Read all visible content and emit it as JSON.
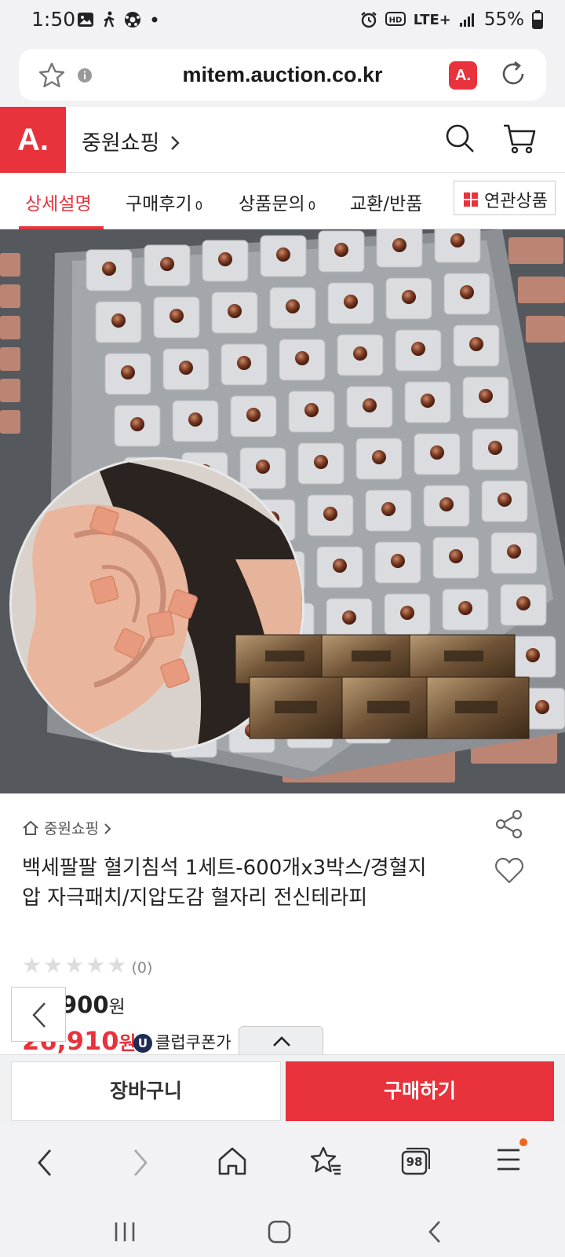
{
  "status_bar": {
    "time": "1:50",
    "network": "LTE+",
    "battery": "55%",
    "icons": [
      "gallery-icon",
      "walking-icon",
      "soccer-icon",
      "dot-icon",
      "alarm-icon",
      "hd-icon",
      "signal-icon",
      "battery-icon"
    ]
  },
  "browser": {
    "url": "mitem.auction.co.kr",
    "extension_badge": "A."
  },
  "site_header": {
    "logo": "A.",
    "shop_name": "중원쇼핑"
  },
  "tabs": [
    {
      "label": "상세설명",
      "count": ""
    },
    {
      "label": "구매후기",
      "count": "0"
    },
    {
      "label": "상품문의",
      "count": "0"
    },
    {
      "label": "교환/반품",
      "count": ""
    }
  ],
  "related_button": "연관상품",
  "product": {
    "breadcrumb": "중원쇼핑",
    "title": "백세팔팔 혈기침석 1세트-600개x3박스/경혈지압 자극패치/지압도감 혈자리 전신테라피",
    "rating_count": "(0)",
    "price_original": "900",
    "price_sale": "26,910",
    "won": "원",
    "coupon_badge": "U",
    "coupon_label": "클럽쿠폰가"
  },
  "buttons": {
    "cart": "장바구니",
    "buy": "구매하기"
  },
  "browser_toolbar": {
    "tab_count": "98"
  },
  "colors": {
    "brand": "#e8323c",
    "coupon": "#1f2b55"
  }
}
